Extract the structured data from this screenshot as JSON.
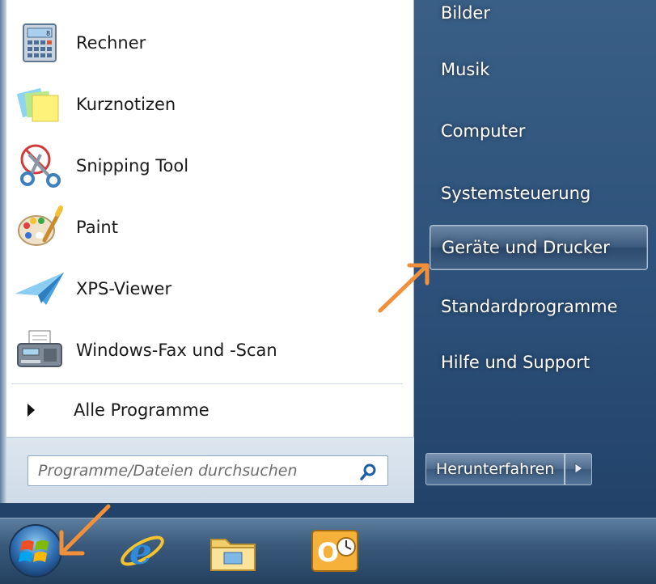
{
  "programs": [
    {
      "label": "Rechner",
      "icon": "calculator-icon"
    },
    {
      "label": "Kurznotizen",
      "icon": "sticky-notes-icon"
    },
    {
      "label": "Snipping Tool",
      "icon": "snipping-tool-icon"
    },
    {
      "label": "Paint",
      "icon": "paint-icon"
    },
    {
      "label": "XPS-Viewer",
      "icon": "xps-viewer-icon"
    },
    {
      "label": "Windows-Fax und -Scan",
      "icon": "fax-scan-icon"
    }
  ],
  "all_programs": {
    "label": "Alle Programme"
  },
  "search": {
    "placeholder": "Programme/Dateien durchsuchen"
  },
  "right_menu": {
    "items": [
      {
        "label": "Bilder"
      },
      {
        "label": "Musik"
      },
      {
        "label": "Computer"
      },
      {
        "label": "Systemsteuerung"
      },
      {
        "label": "Geräte und Drucker",
        "highlighted": true
      },
      {
        "label": "Standardprogramme"
      },
      {
        "label": "Hilfe und Support"
      }
    ],
    "shutdown_label": "Herunterfahren"
  },
  "taskbar": {
    "items": [
      {
        "name": "start-orb-icon"
      },
      {
        "name": "internet-explorer-icon"
      },
      {
        "name": "windows-explorer-icon"
      },
      {
        "name": "outlook-icon"
      }
    ]
  },
  "colors": {
    "annotation_arrow": "#f0903a",
    "panel_blue": "#2b4f78"
  }
}
